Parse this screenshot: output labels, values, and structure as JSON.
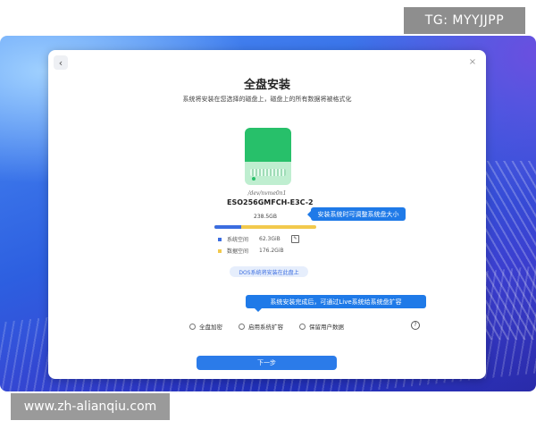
{
  "watermarks": {
    "top": "TG: MYYJJPP",
    "bottom": "www.zh-alianqiu.com"
  },
  "dialog": {
    "title": "全盘安装",
    "subtitle": "系统将安装在您选择的磁盘上，磁盘上的所有数据将被格式化",
    "back_glyph": "‹",
    "close_glyph": "×"
  },
  "disk": {
    "path": "/dev/nvme0n1",
    "model": "ESO256GMFCH-E3C-2",
    "size": "238.5GB",
    "system_fraction": 0.26,
    "colors": {
      "system": "#3b6de0",
      "data": "#f2c94c"
    },
    "legend": [
      {
        "label": "系统空间",
        "value": "62.3GiB"
      },
      {
        "label": "数据空间",
        "value": "176.2GiB"
      }
    ],
    "install_badge": "DOS系统将安装在此盘上"
  },
  "tooltips": {
    "resize": "安装系统时可调整系统盘大小",
    "live": "系统安装完成后，可通过Live系统给系统盘扩容"
  },
  "options": [
    {
      "label": "全盘加密"
    },
    {
      "label": "启用系统扩容"
    },
    {
      "label": "保留用户数据"
    }
  ],
  "help_glyph": "?",
  "next_button": "下一步",
  "accent": "#2b7be9"
}
